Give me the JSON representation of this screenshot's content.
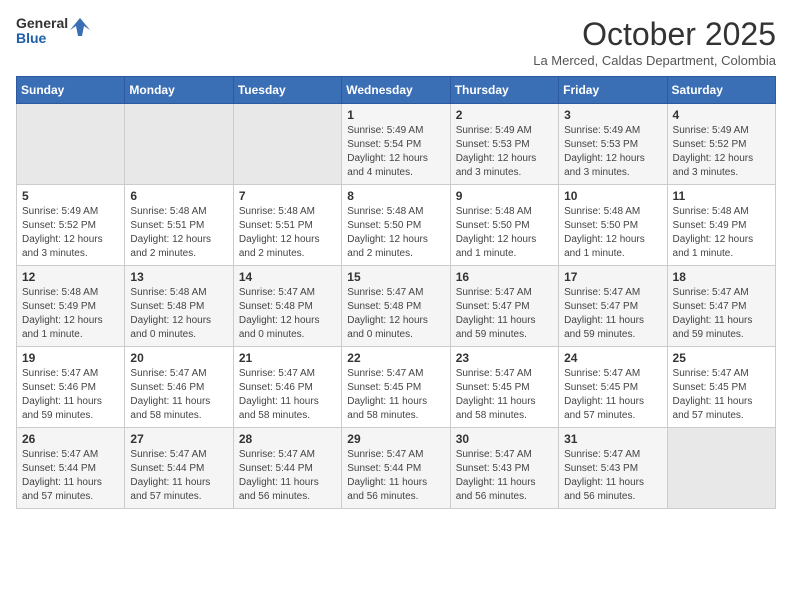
{
  "logo": {
    "line1": "General",
    "line2": "Blue"
  },
  "title": "October 2025",
  "location": "La Merced, Caldas Department, Colombia",
  "days_of_week": [
    "Sunday",
    "Monday",
    "Tuesday",
    "Wednesday",
    "Thursday",
    "Friday",
    "Saturday"
  ],
  "weeks": [
    [
      {
        "day": "",
        "info": ""
      },
      {
        "day": "",
        "info": ""
      },
      {
        "day": "",
        "info": ""
      },
      {
        "day": "1",
        "info": "Sunrise: 5:49 AM\nSunset: 5:54 PM\nDaylight: 12 hours\nand 4 minutes."
      },
      {
        "day": "2",
        "info": "Sunrise: 5:49 AM\nSunset: 5:53 PM\nDaylight: 12 hours\nand 3 minutes."
      },
      {
        "day": "3",
        "info": "Sunrise: 5:49 AM\nSunset: 5:53 PM\nDaylight: 12 hours\nand 3 minutes."
      },
      {
        "day": "4",
        "info": "Sunrise: 5:49 AM\nSunset: 5:52 PM\nDaylight: 12 hours\nand 3 minutes."
      }
    ],
    [
      {
        "day": "5",
        "info": "Sunrise: 5:49 AM\nSunset: 5:52 PM\nDaylight: 12 hours\nand 3 minutes."
      },
      {
        "day": "6",
        "info": "Sunrise: 5:48 AM\nSunset: 5:51 PM\nDaylight: 12 hours\nand 2 minutes."
      },
      {
        "day": "7",
        "info": "Sunrise: 5:48 AM\nSunset: 5:51 PM\nDaylight: 12 hours\nand 2 minutes."
      },
      {
        "day": "8",
        "info": "Sunrise: 5:48 AM\nSunset: 5:50 PM\nDaylight: 12 hours\nand 2 minutes."
      },
      {
        "day": "9",
        "info": "Sunrise: 5:48 AM\nSunset: 5:50 PM\nDaylight: 12 hours\nand 1 minute."
      },
      {
        "day": "10",
        "info": "Sunrise: 5:48 AM\nSunset: 5:50 PM\nDaylight: 12 hours\nand 1 minute."
      },
      {
        "day": "11",
        "info": "Sunrise: 5:48 AM\nSunset: 5:49 PM\nDaylight: 12 hours\nand 1 minute."
      }
    ],
    [
      {
        "day": "12",
        "info": "Sunrise: 5:48 AM\nSunset: 5:49 PM\nDaylight: 12 hours\nand 1 minute."
      },
      {
        "day": "13",
        "info": "Sunrise: 5:48 AM\nSunset: 5:48 PM\nDaylight: 12 hours\nand 0 minutes."
      },
      {
        "day": "14",
        "info": "Sunrise: 5:47 AM\nSunset: 5:48 PM\nDaylight: 12 hours\nand 0 minutes."
      },
      {
        "day": "15",
        "info": "Sunrise: 5:47 AM\nSunset: 5:48 PM\nDaylight: 12 hours\nand 0 minutes."
      },
      {
        "day": "16",
        "info": "Sunrise: 5:47 AM\nSunset: 5:47 PM\nDaylight: 11 hours\nand 59 minutes."
      },
      {
        "day": "17",
        "info": "Sunrise: 5:47 AM\nSunset: 5:47 PM\nDaylight: 11 hours\nand 59 minutes."
      },
      {
        "day": "18",
        "info": "Sunrise: 5:47 AM\nSunset: 5:47 PM\nDaylight: 11 hours\nand 59 minutes."
      }
    ],
    [
      {
        "day": "19",
        "info": "Sunrise: 5:47 AM\nSunset: 5:46 PM\nDaylight: 11 hours\nand 59 minutes."
      },
      {
        "day": "20",
        "info": "Sunrise: 5:47 AM\nSunset: 5:46 PM\nDaylight: 11 hours\nand 58 minutes."
      },
      {
        "day": "21",
        "info": "Sunrise: 5:47 AM\nSunset: 5:46 PM\nDaylight: 11 hours\nand 58 minutes."
      },
      {
        "day": "22",
        "info": "Sunrise: 5:47 AM\nSunset: 5:45 PM\nDaylight: 11 hours\nand 58 minutes."
      },
      {
        "day": "23",
        "info": "Sunrise: 5:47 AM\nSunset: 5:45 PM\nDaylight: 11 hours\nand 58 minutes."
      },
      {
        "day": "24",
        "info": "Sunrise: 5:47 AM\nSunset: 5:45 PM\nDaylight: 11 hours\nand 57 minutes."
      },
      {
        "day": "25",
        "info": "Sunrise: 5:47 AM\nSunset: 5:45 PM\nDaylight: 11 hours\nand 57 minutes."
      }
    ],
    [
      {
        "day": "26",
        "info": "Sunrise: 5:47 AM\nSunset: 5:44 PM\nDaylight: 11 hours\nand 57 minutes."
      },
      {
        "day": "27",
        "info": "Sunrise: 5:47 AM\nSunset: 5:44 PM\nDaylight: 11 hours\nand 57 minutes."
      },
      {
        "day": "28",
        "info": "Sunrise: 5:47 AM\nSunset: 5:44 PM\nDaylight: 11 hours\nand 56 minutes."
      },
      {
        "day": "29",
        "info": "Sunrise: 5:47 AM\nSunset: 5:44 PM\nDaylight: 11 hours\nand 56 minutes."
      },
      {
        "day": "30",
        "info": "Sunrise: 5:47 AM\nSunset: 5:43 PM\nDaylight: 11 hours\nand 56 minutes."
      },
      {
        "day": "31",
        "info": "Sunrise: 5:47 AM\nSunset: 5:43 PM\nDaylight: 11 hours\nand 56 minutes."
      },
      {
        "day": "",
        "info": ""
      }
    ]
  ]
}
